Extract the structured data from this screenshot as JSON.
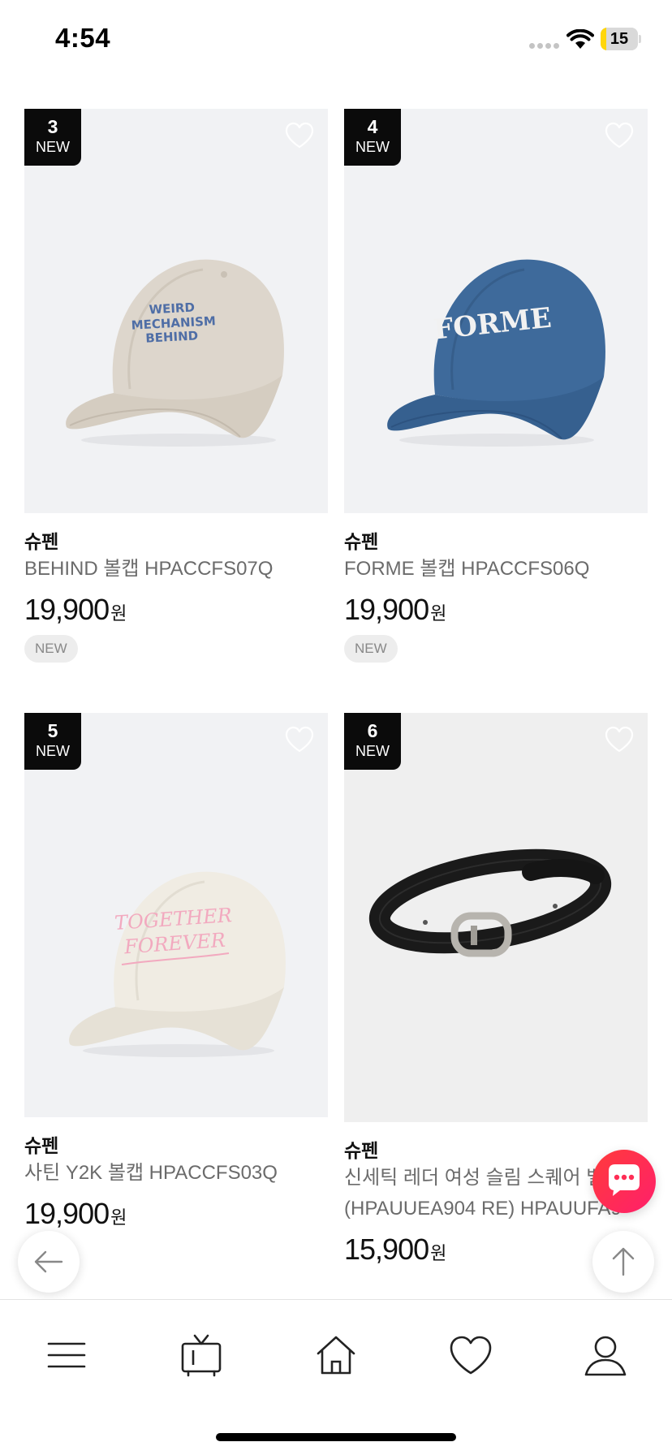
{
  "status_bar": {
    "time": "4:54",
    "battery": "15",
    "battery_level": 0.15
  },
  "products": [
    {
      "rank": "3",
      "rank_tag": "NEW",
      "brand": "슈펜",
      "name": "BEHIND 볼캡 HPACCFS07Q",
      "price": "19,900",
      "currency": "원",
      "tag": "NEW",
      "image": "beige-cap-image"
    },
    {
      "rank": "4",
      "rank_tag": "NEW",
      "brand": "슈펜",
      "name": "FORME 볼캡 HPACCFS06Q",
      "price": "19,900",
      "currency": "원",
      "tag": "NEW",
      "image": "blue-cap-image"
    },
    {
      "rank": "5",
      "rank_tag": "NEW",
      "brand": "슈펜",
      "name": "사틴 Y2K 볼캡 HPACCFS03Q",
      "price": "19,900",
      "currency": "원",
      "image": "satin-cap-image"
    },
    {
      "rank": "6",
      "rank_tag": "NEW",
      "brand": "슈펜",
      "name": "신세틱 레더 여성 슬림 스퀘어 벨트 (HPAUUEA904 RE) HPAUUFA9",
      "price": "15,900",
      "currency": "원",
      "image": "black-belt-image"
    }
  ],
  "cap_prints": {
    "behind": [
      "WEIRD",
      "MECHANISM",
      "BEHIND"
    ],
    "forme": "FORME",
    "satin": [
      "TOGETHER",
      "FOREVER"
    ]
  },
  "icons": {
    "wishlist": "heart-outline-icon",
    "chat": "chat-bubble-icon",
    "back": "arrow-left-icon",
    "scroll_top": "arrow-up-icon",
    "tabs": [
      "menu-icon",
      "tv-icon",
      "home-icon",
      "heart-icon",
      "person-icon"
    ]
  },
  "colors": {
    "badge": "#0b0b0b",
    "chat_fab": "#ff2d55",
    "tag_bg": "#ededed",
    "price": "#111111",
    "name": "#6b6b6b"
  }
}
